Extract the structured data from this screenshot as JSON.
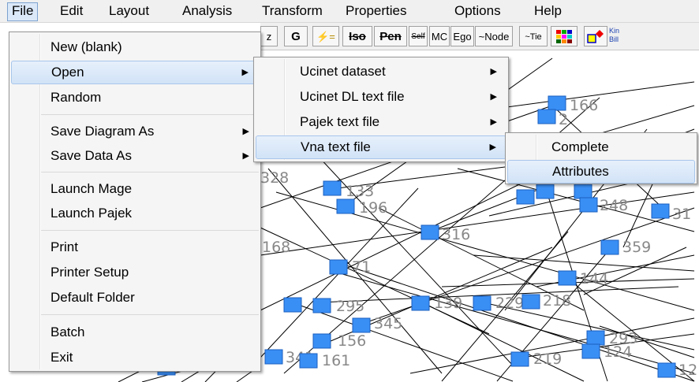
{
  "menubar": {
    "items": [
      "File",
      "Edit",
      "Layout",
      "Analysis",
      "Transform",
      "Properties",
      "Options",
      "Help"
    ]
  },
  "toolbar": {
    "buttons": [
      "z",
      "G",
      "⚡=",
      "Iso",
      "Pen",
      "Self",
      "MC",
      "Ego",
      "~Node",
      "~Tie",
      "Kin",
      "Bill"
    ]
  },
  "file_menu": {
    "new": "New (blank)",
    "open": "Open",
    "random": "Random",
    "save_diagram": "Save Diagram As",
    "save_data": "Save Data As",
    "launch_mage": "Launch Mage",
    "launch_pajek": "Launch Pajek",
    "print": "Print",
    "printer_setup": "Printer Setup",
    "default_folder": "Default Folder",
    "batch": "Batch",
    "exit": "Exit"
  },
  "open_menu": {
    "ucinet_dataset": "Ucinet dataset",
    "ucinet_dl": "Ucinet DL text file",
    "pajek": "Pajek text file",
    "vna": "Vna text file"
  },
  "vna_menu": {
    "complete": "Complete",
    "attributes": "Attributes"
  },
  "network": {
    "node_color": "#3a8ff5",
    "labels": [
      "166",
      "2",
      "328",
      "133",
      "196",
      "248",
      "31",
      "316",
      "168",
      "359",
      "71",
      "144",
      "295",
      "139",
      "229",
      "218",
      "345",
      "156",
      "293",
      "124",
      "341",
      "161",
      "219",
      "12"
    ]
  }
}
